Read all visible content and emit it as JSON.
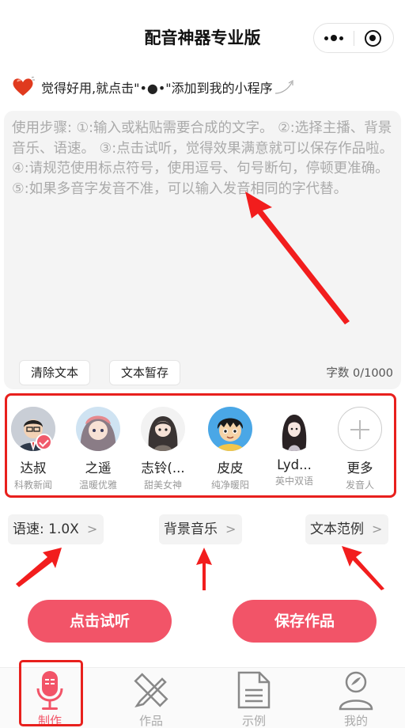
{
  "header": {
    "title": "配音神器专业版"
  },
  "tip": {
    "text": "觉得好用,就点击\"•●•\"添加到我的小程序"
  },
  "editor": {
    "placeholder": "使用步骤: ①:输入或粘贴需要合成的文字。 ②:选择主播、背景音乐、语速。 ③:点击试听，觉得效果满意就可以保存作品啦。 ④:请规范使用标点符号，使用逗号、句号断句，停顿更准确。 ⑤:如果多音字发音不准，可以输入发音相同的字代替。",
    "clear_label": "清除文本",
    "save_draft_label": "文本暂存",
    "count_text": "字数 0/1000"
  },
  "voices": [
    {
      "name": "达叔",
      "desc": "科教新闻",
      "selected": true
    },
    {
      "name": "之遥",
      "desc": "温暖优雅"
    },
    {
      "name": "志铃(...",
      "desc": "甜美女神"
    },
    {
      "name": "皮皮",
      "desc": "纯净暖阳"
    },
    {
      "name": "Lyd...",
      "desc": "英中双语"
    },
    {
      "name": "更多",
      "desc": "发音人"
    }
  ],
  "options": {
    "speed_label": "语速: 1.0X",
    "bgm_label": "背景音乐",
    "sample_label": "文本范例",
    "chevron": ">"
  },
  "actions": {
    "preview_label": "点击试听",
    "save_label": "保存作品"
  },
  "tabs": [
    {
      "label": "制作",
      "icon": "microphone-icon",
      "active": true
    },
    {
      "label": "作品",
      "icon": "pencil-ruler-icon"
    },
    {
      "label": "示例",
      "icon": "document-icon"
    },
    {
      "label": "我的",
      "icon": "user-icon"
    }
  ],
  "colors": {
    "accent": "#f25468",
    "highlight": "#e8201d",
    "arrow": "#f21d1d"
  }
}
